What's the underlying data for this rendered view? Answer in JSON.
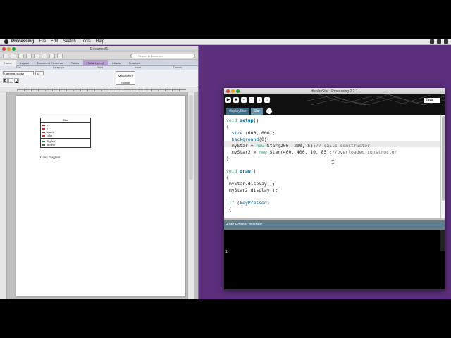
{
  "menubar": {
    "app_name": "Processing",
    "items": [
      "File",
      "Edit",
      "Sketch",
      "Tools",
      "Help"
    ]
  },
  "word": {
    "doc_title": "Document1",
    "search_placeholder": "Search in Document",
    "ribbon_tabs": [
      "Home",
      "Layout",
      "Document Elements",
      "Tables",
      "Table Layout",
      "Charts",
      "SmartArt",
      "Review"
    ],
    "ribbon_groups": [
      "Font",
      "Paragraph",
      "Styles",
      "Insert",
      "Themes"
    ],
    "font_name": "Cambria (Body)",
    "font_size": "12",
    "format_buttons": [
      "B",
      "I",
      "U"
    ],
    "style_sample": "AaBbCcDdEe",
    "style_name": "Normal",
    "uml": {
      "class_name": "Star",
      "attributes": [
        "x",
        "y",
        "square",
        "color"
      ],
      "methods": [
        "display()",
        "move()"
      ]
    },
    "caption": "Class diagram"
  },
  "processing": {
    "window_title": "displayStar | Processing 2.2.1",
    "mode": "Java",
    "tabs": [
      "displayStar",
      "Star"
    ],
    "code_lines": [
      [
        "void",
        " ",
        "setup",
        "()"
      ],
      [
        "{"
      ],
      [
        "  ",
        "size",
        " (600, 600);"
      ],
      [
        "  ",
        "background",
        "(0);"
      ],
      [
        "  myStar = ",
        "new",
        " Star(200, 200, 5);",
        "// calls constructor"
      ],
      [
        "  myStar2 = ",
        "new",
        " Star(400, 400, 10, 85);",
        "//overloaded constructor"
      ],
      [
        "}"
      ],
      [
        ""
      ],
      [
        "void",
        " ",
        "draw",
        "()"
      ],
      [
        "{"
      ],
      [
        " myStar.display();"
      ],
      [
        " myStar2.display();"
      ],
      [
        ""
      ],
      [
        " ",
        "if",
        " (",
        "keyPressed",
        ")"
      ],
      [
        " {"
      ]
    ],
    "status_message": "Auto Format finished."
  }
}
